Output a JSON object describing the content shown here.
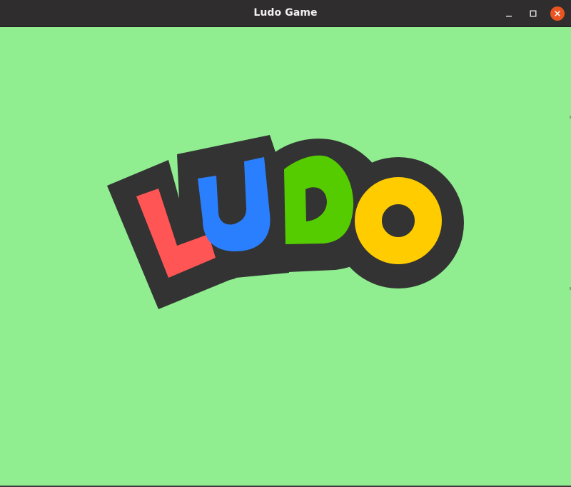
{
  "window": {
    "title": "Ludo Game",
    "controls": {
      "minimize": "minimize-icon",
      "maximize": "maximize-icon",
      "close": "close-icon"
    }
  },
  "logo": {
    "text": "LUDO",
    "letters": [
      {
        "char": "L",
        "color": "#ff5555"
      },
      {
        "char": "U",
        "color": "#2a7fff"
      },
      {
        "char": "D",
        "color": "#55cc00"
      },
      {
        "char": "O",
        "color": "#ffcc00"
      }
    ],
    "outline_color": "#333333"
  },
  "colors": {
    "background": "#90ee90",
    "titlebar": "#2f2d2d",
    "close_button": "#e95420"
  }
}
